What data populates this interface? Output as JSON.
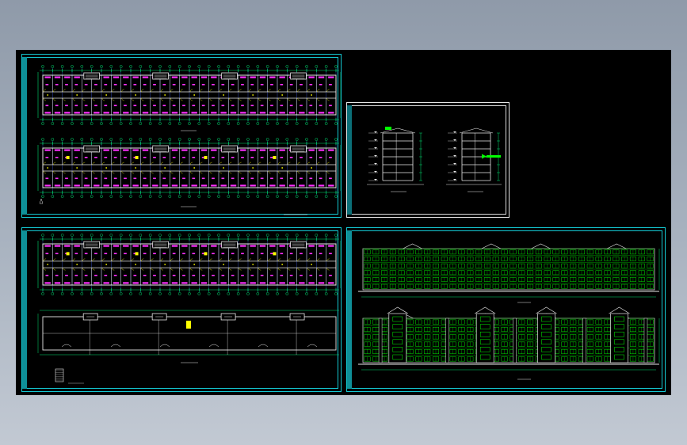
{
  "canvas": {
    "background": "#000000"
  },
  "colors": {
    "frame": "#14c8d2",
    "wall": "#e8e8e8",
    "grid": "#4466ff",
    "dimension": "#00e070",
    "room": "#ff30ff",
    "fixture": "#ffff00",
    "elevation": "#00c800",
    "window": "#00ff00"
  },
  "sheets": [
    {
      "id": "floor-plans-sheet",
      "content": [
        "ground-floor-plan",
        "typical-floor-plan"
      ]
    },
    {
      "id": "section-sheet",
      "content": [
        "building-section-1",
        "building-section-2"
      ]
    },
    {
      "id": "upper-plans-sheet",
      "content": [
        "upper-floor-plan",
        "roof-plan",
        "stair-detail"
      ]
    },
    {
      "id": "elevation-sheet",
      "content": [
        "rear-elevation",
        "front-elevation"
      ]
    }
  ],
  "layout": {
    "tower_count": 4,
    "plan_bays": 30,
    "elevation_bays": 34,
    "floors": 6
  }
}
